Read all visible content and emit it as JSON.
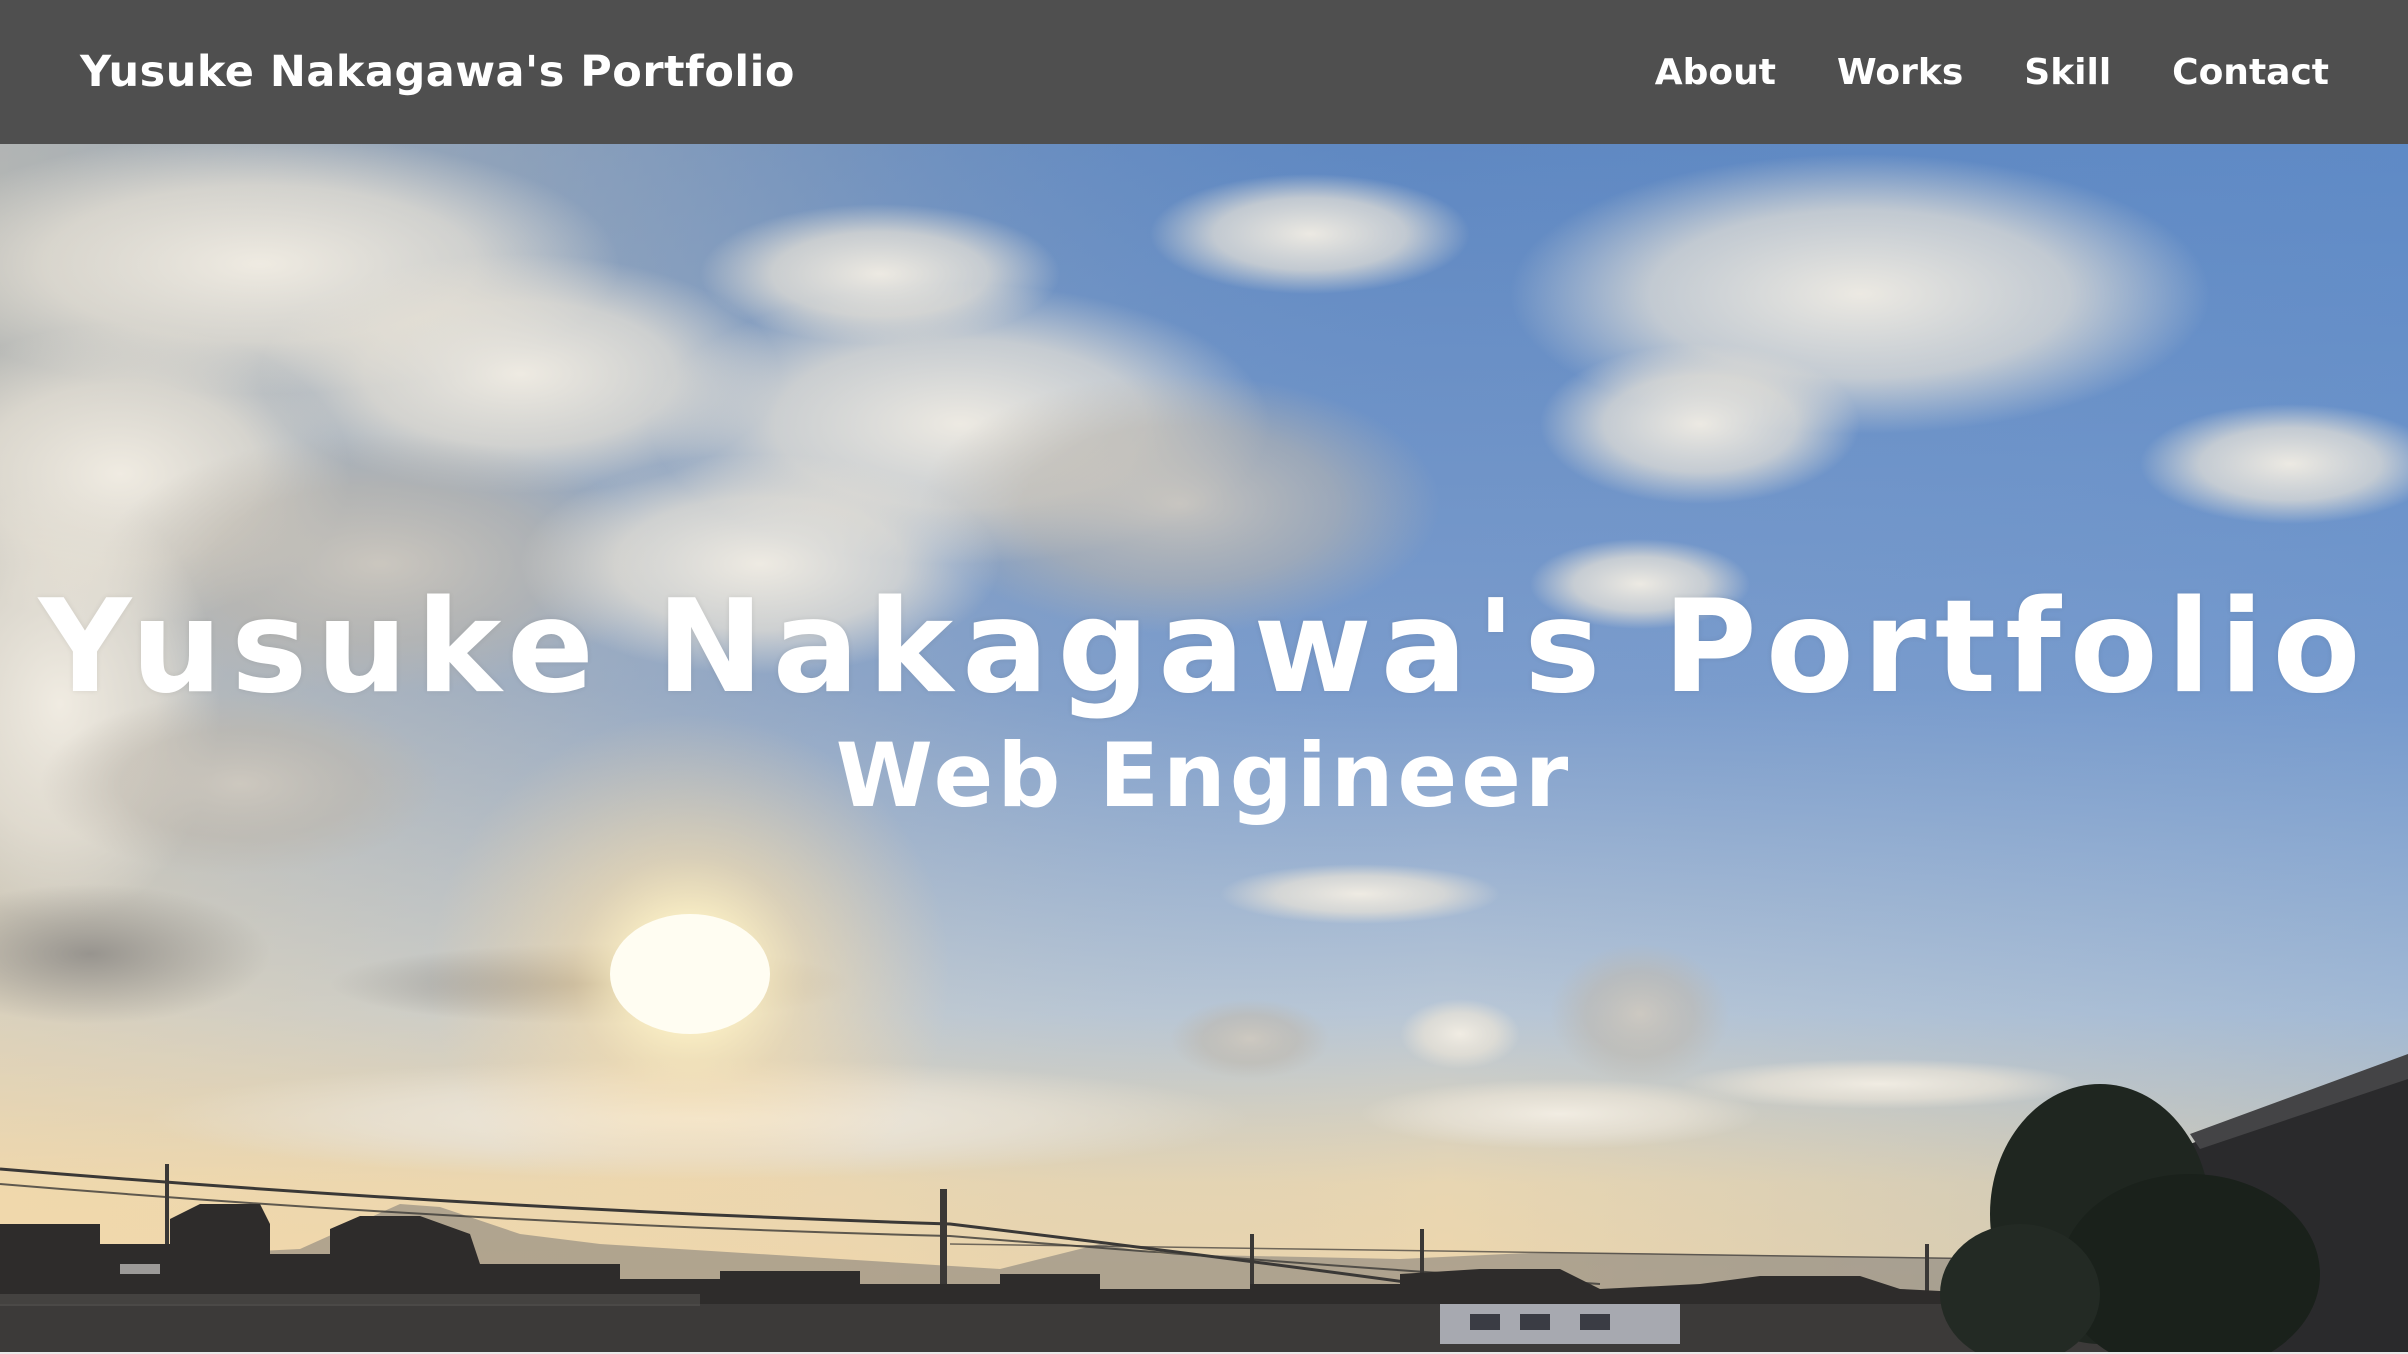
{
  "header": {
    "title": "Yusuke Nakagawa's Portfolio",
    "background": "#4f4f4f",
    "nav": [
      {
        "label": "About"
      },
      {
        "label": "Works"
      },
      {
        "label": "Skill"
      },
      {
        "label": "Contact"
      }
    ]
  },
  "hero": {
    "title": "Yusuke Nakagawa's Portfolio",
    "subtitle": "Web Engineer",
    "background_image": "sunset-sky-photo"
  }
}
